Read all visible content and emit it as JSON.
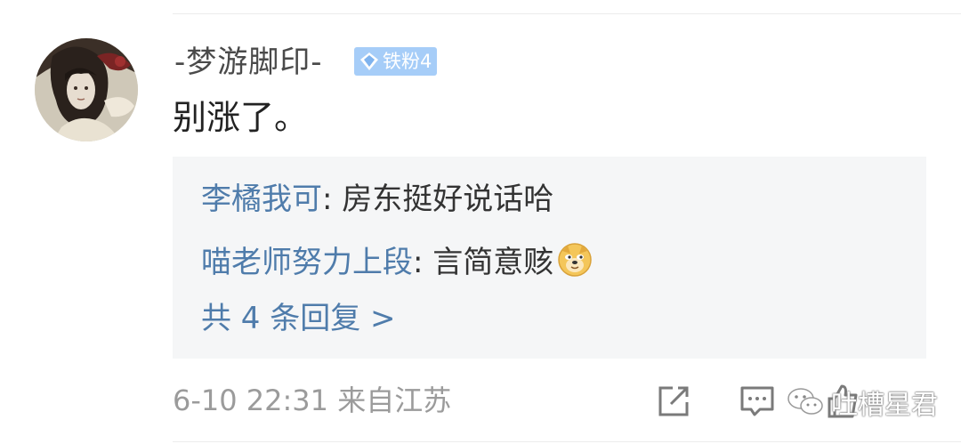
{
  "comment": {
    "username": "-梦游脚印-",
    "fan_badge": {
      "icon": "diamond-icon",
      "label": "铁粉4"
    },
    "text": "别涨了。",
    "replies": [
      {
        "name": "李橘我可",
        "separator": ": ",
        "text": "房东挺好说话哈",
        "emoji": null
      },
      {
        "name": "喵老师努力上段",
        "separator": ": ",
        "text": "言简意赅",
        "emoji": "doge-emoji-icon"
      }
    ],
    "more_replies": "共 4 条回复 >",
    "timestamp": "6-10 22:31 来自江苏",
    "actions": [
      "share-icon",
      "comment-icon",
      "like-icon"
    ]
  },
  "watermark": {
    "icon": "wechat-icon",
    "text": "吐槽星君"
  },
  "colors": {
    "link_blue": "#4f7cab",
    "badge_blue": "#a6cdf8",
    "reply_bg": "#f5f6f7",
    "meta_gray": "#9b9b9b"
  }
}
